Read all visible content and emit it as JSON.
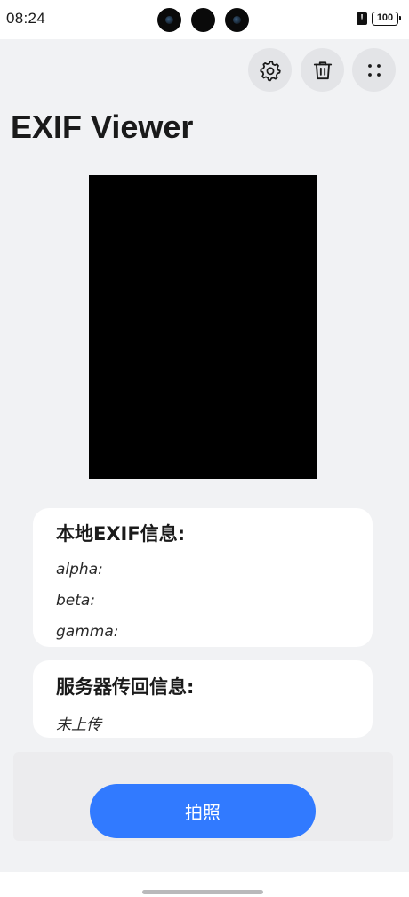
{
  "status_bar": {
    "time": "08:24",
    "alert_glyph": "!",
    "battery": "100"
  },
  "toolbar": {
    "icons": [
      "gear-icon",
      "trash-icon",
      "more-dots-icon"
    ]
  },
  "page": {
    "title": "EXIF Viewer"
  },
  "local_exif": {
    "title": "本地EXIF信息:",
    "alpha_label": "alpha:",
    "beta_label": "beta:",
    "gamma_label": "gamma:"
  },
  "server_info": {
    "title": "服务器传回信息:",
    "status": "未上传"
  },
  "action": {
    "capture_label": "拍照"
  },
  "colors": {
    "background": "#f1f2f4",
    "accent": "#317aff",
    "card": "#ffffff",
    "preview": "#000000"
  }
}
